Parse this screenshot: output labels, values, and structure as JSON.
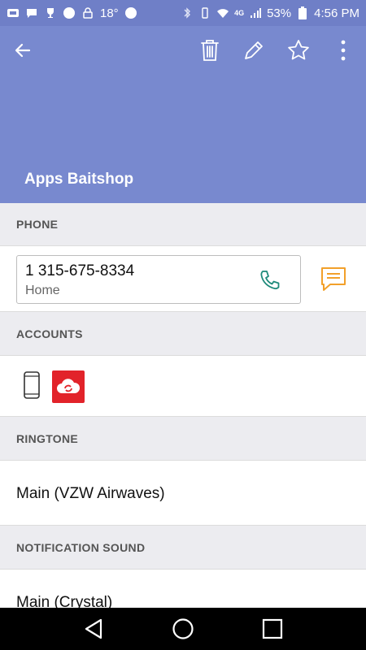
{
  "status_bar": {
    "temperature": "18°",
    "network": "4G",
    "battery": "53%",
    "time": "4:56 PM"
  },
  "header": {
    "contact_name": "Apps Baitshop",
    "color": "#7889cf"
  },
  "sections": {
    "phone_label": "PHONE",
    "phone_number": "1 315-675-8334",
    "phone_type": "Home",
    "accounts_label": "ACCOUNTS",
    "ringtone_label": "RINGTONE",
    "ringtone_value": "Main (VZW Airwaves)",
    "notification_label": "NOTIFICATION SOUND",
    "notification_value": "Main (Crystal)"
  },
  "icons": {
    "back": "arrow-left-icon",
    "delete": "trash-icon",
    "edit": "pencil-icon",
    "favorite": "star-icon",
    "more": "more-vertical-icon",
    "call": "phone-icon",
    "message": "message-icon",
    "device_account": "phone-device-icon",
    "cloud_account": "cloud-sync-icon"
  },
  "colors": {
    "accent_orange": "#f2a02a",
    "call_green": "#1e8a7a",
    "account_red": "#e2232a"
  }
}
